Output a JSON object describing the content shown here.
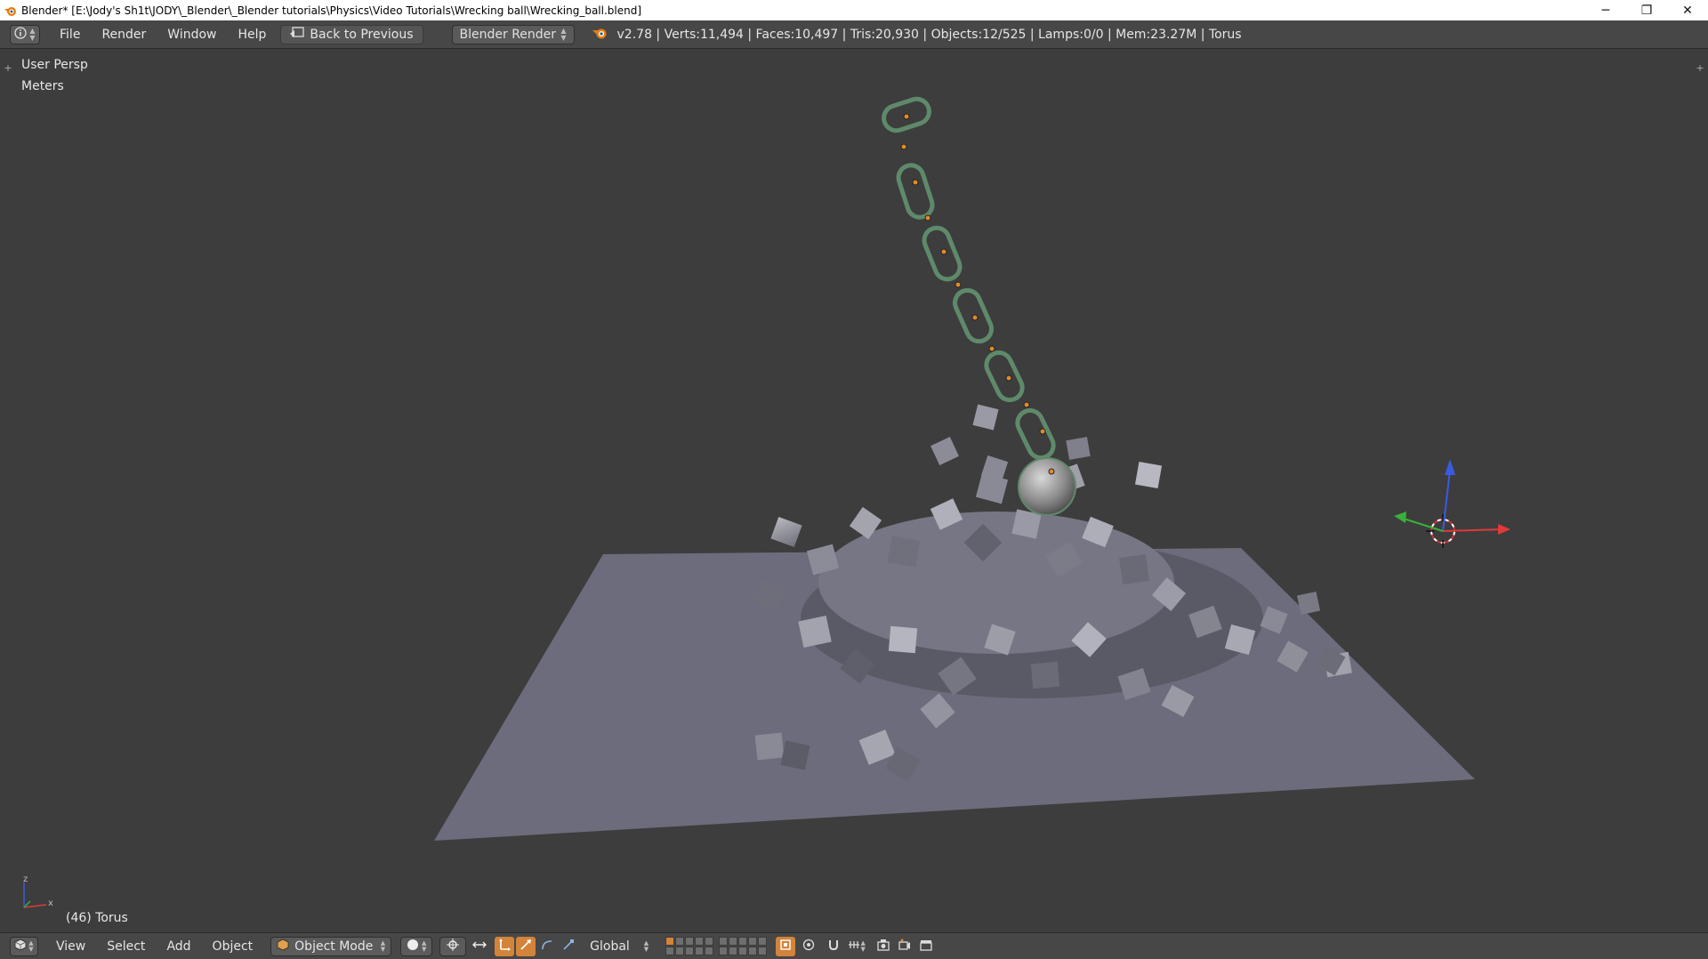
{
  "window": {
    "title": "Blender* [E:\\Jody's Sh1t\\JODY\\_Blender\\_Blender tutorials\\Physics\\Video Tutorials\\Wrecking ball\\Wrecking_ball.blend]",
    "minimize": "─",
    "restore": "❐",
    "close": "✕"
  },
  "topbar": {
    "menus": [
      "File",
      "Render",
      "Window",
      "Help"
    ],
    "back_label": "Back to Previous",
    "engine": "Blender Render",
    "stats": "v2.78 | Verts:11,494 | Faces:10,497 | Tris:20,930 | Objects:12/525 | Lamps:0/0 | Mem:23.27M | Torus"
  },
  "viewport": {
    "view_name": "User Persp",
    "units": "Meters",
    "active_object": "(46) Torus",
    "axis_z": "z",
    "axis_x": "x"
  },
  "bottombar": {
    "menus": [
      "View",
      "Select",
      "Add",
      "Object"
    ],
    "mode": "Object Mode",
    "orientation": "Global"
  },
  "colors": {
    "accent": "#d2843a",
    "axis_x": "#e03a3a",
    "axis_y": "#3ab03a",
    "axis_z": "#3a5ae0",
    "plane": "#6d6d7d",
    "chain": "#5e8a6a"
  }
}
